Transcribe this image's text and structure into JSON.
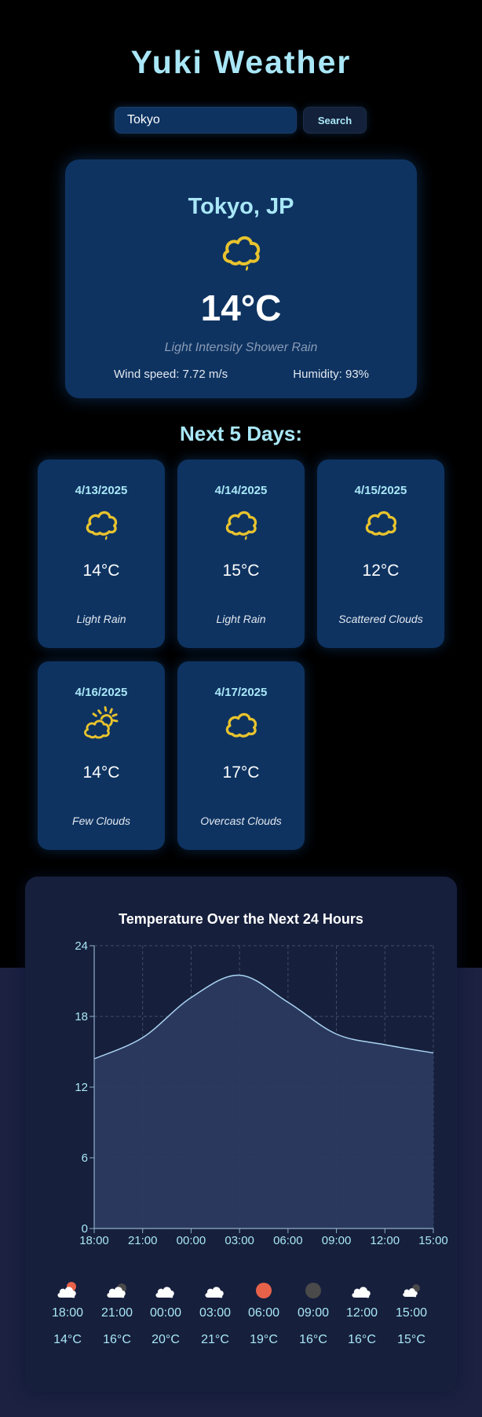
{
  "app": {
    "title": "Yuki Weather"
  },
  "search": {
    "value": "Tokyo",
    "button_label": "Search"
  },
  "current": {
    "city": "Tokyo, JP",
    "icon": "shower-rain-cloud-icon",
    "temperature": "14°C",
    "description": "Light Intensity Shower Rain",
    "wind": "Wind speed: 7.72 m/s",
    "humidity": "Humidity: 93%"
  },
  "forecast": {
    "heading": "Next 5 Days:",
    "days": [
      {
        "date": "4/13/2025",
        "icon": "rain-cloud-icon",
        "temp": "14°C",
        "desc": "Light Rain"
      },
      {
        "date": "4/14/2025",
        "icon": "rain-cloud-icon",
        "temp": "15°C",
        "desc": "Light Rain"
      },
      {
        "date": "4/15/2025",
        "icon": "cloud-icon",
        "temp": "12°C",
        "desc": "Scattered Clouds"
      },
      {
        "date": "4/16/2025",
        "icon": "sun-behind-cloud-icon",
        "temp": "14°C",
        "desc": "Few Clouds"
      },
      {
        "date": "4/17/2025",
        "icon": "cloud-icon",
        "temp": "17°C",
        "desc": "Overcast Clouds"
      }
    ]
  },
  "colors": {
    "accent": "#a9e7f7",
    "card": "#0e3361",
    "icon_yellow": "#e8c32e",
    "chart_line": "#a9d4f0",
    "chart_fill": "#2c3a60"
  },
  "hourly": [
    {
      "time": "18:00",
      "temp": "14°C",
      "icon": "cloud-with-red-sun-icon"
    },
    {
      "time": "21:00",
      "temp": "16°C",
      "icon": "cloud-with-moon-icon"
    },
    {
      "time": "00:00",
      "temp": "20°C",
      "icon": "cloud-icon"
    },
    {
      "time": "03:00",
      "temp": "21°C",
      "icon": "cloud-icon"
    },
    {
      "time": "06:00",
      "temp": "19°C",
      "icon": "red-sun-icon"
    },
    {
      "time": "09:00",
      "temp": "16°C",
      "icon": "dark-moon-icon"
    },
    {
      "time": "12:00",
      "temp": "16°C",
      "icon": "cloud-icon"
    },
    {
      "time": "15:00",
      "temp": "15°C",
      "icon": "cloud-with-moon-icon"
    }
  ],
  "chart_data": {
    "type": "area",
    "title": "Temperature Over the Next 24 Hours",
    "xlabel": "",
    "ylabel": "",
    "x": [
      "18:00",
      "21:00",
      "00:00",
      "03:00",
      "06:00",
      "09:00",
      "12:00",
      "15:00"
    ],
    "values": [
      14.4,
      16.2,
      19.6,
      21.5,
      19.2,
      16.5,
      15.6,
      14.9
    ],
    "ylim": [
      0,
      24
    ],
    "yticks": [
      0,
      6,
      12,
      18,
      24
    ],
    "grid": true,
    "legend": "none"
  }
}
